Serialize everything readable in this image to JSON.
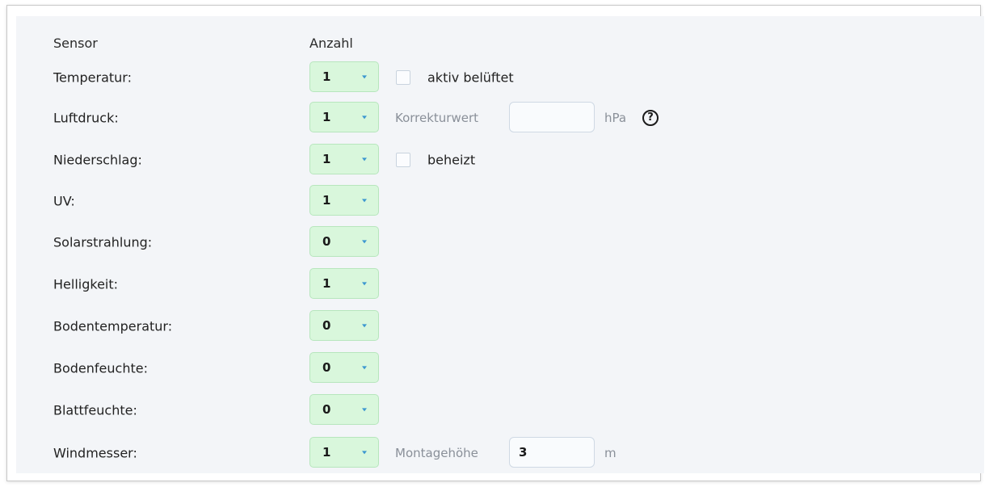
{
  "header": {
    "sensor": "Sensor",
    "anzahl": "Anzahl"
  },
  "rows": {
    "temperatur": {
      "label": "Temperatur:",
      "count": "1",
      "checkbox_label": "aktiv belüftet",
      "checked": false
    },
    "luftdruck": {
      "label": "Luftdruck:",
      "count": "1",
      "correction_label": "Korrekturwert",
      "correction_value": "",
      "unit": "hPa",
      "help_icon": "?"
    },
    "niederschlag": {
      "label": "Niederschlag:",
      "count": "1",
      "checkbox_label": "beheizt",
      "checked": false
    },
    "uv": {
      "label": "UV:",
      "count": "1"
    },
    "solarstrahlung": {
      "label": "Solarstrahlung:",
      "count": "0"
    },
    "helligkeit": {
      "label": "Helligkeit:",
      "count": "1"
    },
    "bodentemperatur": {
      "label": "Bodentemperatur:",
      "count": "0"
    },
    "bodenfeuchte": {
      "label": "Bodenfeuchte:",
      "count": "0"
    },
    "blattfeuchte": {
      "label": "Blattfeuchte:",
      "count": "0"
    },
    "windmesser": {
      "label": "Windmesser:",
      "count": "1",
      "height_label": "Montagehöhe",
      "height_value": "3",
      "unit": "m"
    }
  },
  "colors": {
    "select_bg": "#d9f7dc",
    "caret": "#3c97d0",
    "panel_bg": "#f3f5f8"
  }
}
